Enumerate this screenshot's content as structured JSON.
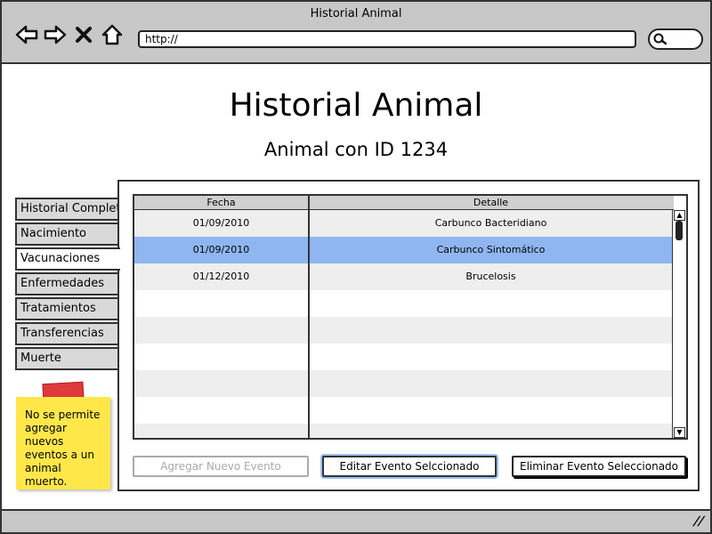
{
  "window": {
    "title": "Historial Animal",
    "url": "http://"
  },
  "page": {
    "title": "Historial Animal",
    "subtitle": "Animal con ID 1234"
  },
  "tabs": [
    {
      "label": "Historial Completo",
      "active": false
    },
    {
      "label": "Nacimiento",
      "active": false
    },
    {
      "label": "Vacunaciones",
      "active": true
    },
    {
      "label": "Enfermedades",
      "active": false
    },
    {
      "label": "Tratamientos",
      "active": false
    },
    {
      "label": "Transferencias",
      "active": false
    },
    {
      "label": "Muerte",
      "active": false
    }
  ],
  "table": {
    "columns": [
      "Fecha",
      "Detalle"
    ],
    "rows": [
      {
        "fecha": "01/09/2010",
        "detalle": "Carbunco Bacteridiano",
        "selected": false
      },
      {
        "fecha": "01/09/2010",
        "detalle": "Carbunco Sintomático",
        "selected": true
      },
      {
        "fecha": "01/12/2010",
        "detalle": "Brucelosis",
        "selected": false
      },
      {
        "fecha": "",
        "detalle": "",
        "selected": false
      },
      {
        "fecha": "",
        "detalle": "",
        "selected": false
      },
      {
        "fecha": "",
        "detalle": "",
        "selected": false
      },
      {
        "fecha": "",
        "detalle": "",
        "selected": false
      },
      {
        "fecha": "",
        "detalle": "",
        "selected": false
      },
      {
        "fecha": "",
        "detalle": "",
        "selected": false
      }
    ]
  },
  "buttons": {
    "add": "Agregar Nuevo Evento",
    "edit": "Editar Evento Selccionado",
    "delete": "Eliminar Evento Seleccionado"
  },
  "note": {
    "text": "No se permite agregar nuevos eventos a un animal muerto."
  },
  "colors": {
    "selected_row": "#8fb6f0",
    "sticky_note": "#ffe74a",
    "tape": "#e0393b",
    "chrome": "#c8c8c8"
  }
}
